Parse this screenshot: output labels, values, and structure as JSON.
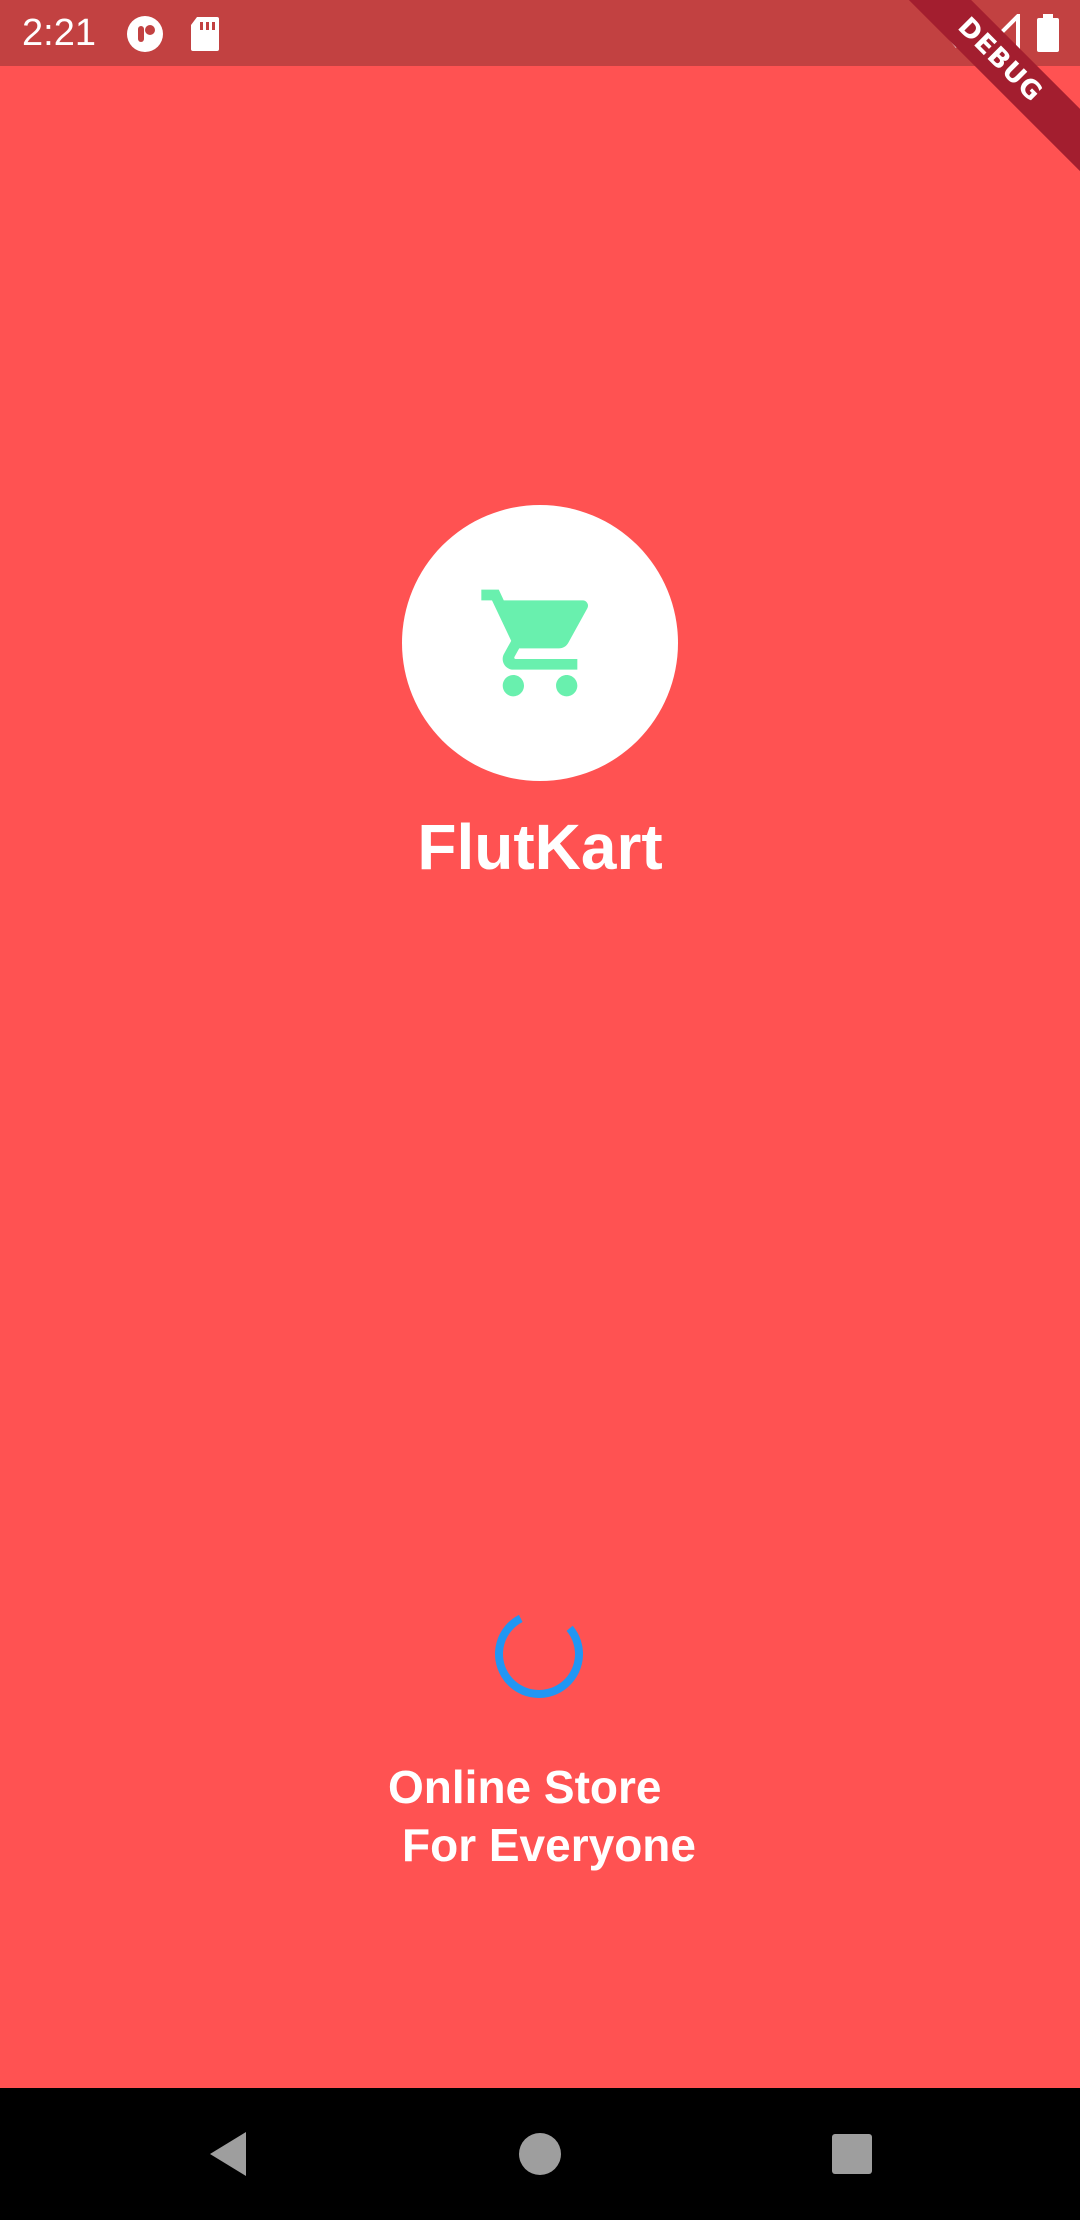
{
  "status_bar": {
    "time": "2:21",
    "left_icons": [
      "app-notification-icon",
      "sd-card-icon"
    ],
    "right_icons": [
      "wifi-icon",
      "cell-signal-icon",
      "battery-icon"
    ]
  },
  "debug_banner": {
    "label": "DEBUG"
  },
  "app": {
    "title": "FlutKart",
    "logo_icon": "shopping-cart-icon",
    "tagline_line1": "Online Store",
    "tagline_line2": "For Everyone"
  },
  "nav_bar": {
    "buttons": [
      "back-icon",
      "home-icon",
      "recents-icon"
    ]
  },
  "colors": {
    "background": "#ff5252",
    "status_bar": "#c24141",
    "logo_icon": "#69f0ae",
    "spinner": "#2196f3",
    "text": "#ffffff"
  }
}
